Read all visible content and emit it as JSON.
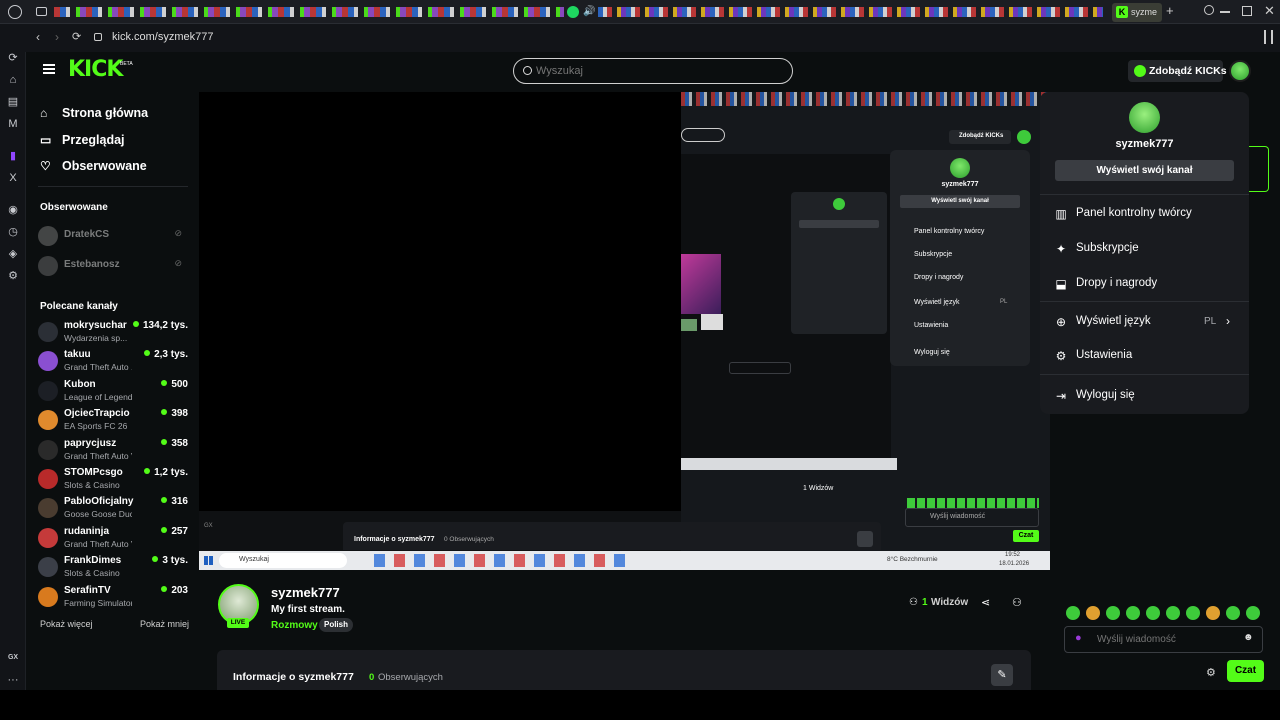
{
  "browser": {
    "tab_label": "syzme",
    "url": "kick.com/syzmek777"
  },
  "header": {
    "logo": "KICK",
    "logo_badge": "BETA",
    "search_placeholder": "Wyszukaj",
    "get_kicks": "Zdobądź KICKs"
  },
  "leftnav": {
    "main": [
      {
        "label": "Strona główna",
        "icon": "home-icon"
      },
      {
        "label": "Przeglądaj",
        "icon": "browse-icon"
      },
      {
        "label": "Obserwowane",
        "icon": "heart-icon"
      }
    ],
    "followed_title": "Obserwowane",
    "followed": [
      {
        "name": "DratekCS"
      },
      {
        "name": "Estebanosz"
      }
    ],
    "recommended_title": "Polecane kanały",
    "recommended": [
      {
        "name": "mokrysuchar",
        "game": "Wydarzenia sp...",
        "viewers": "134,2 tys.",
        "color": "#2b2f36"
      },
      {
        "name": "takuu",
        "game": "Grand Theft Auto ...",
        "viewers": "2,3 tys.",
        "color": "#8a4fd1"
      },
      {
        "name": "Kubon",
        "game": "League of Legends",
        "viewers": "500",
        "color": "#1c1f25"
      },
      {
        "name": "OjciecTrapcio",
        "game": "EA Sports FC 26",
        "viewers": "398",
        "color": "#e08a2d"
      },
      {
        "name": "paprycjusz",
        "game": "Grand Theft Auto V (G...",
        "viewers": "358",
        "color": "#2a2a2a"
      },
      {
        "name": "STOMPcsgo",
        "game": "Slots & Casino",
        "viewers": "1,2 tys.",
        "color": "#b82a2a"
      },
      {
        "name": "PabloOficjalny",
        "game": "Goose Goose Duck",
        "viewers": "316",
        "color": "#4a3c30"
      },
      {
        "name": "rudaninja",
        "game": "Grand Theft Auto V (G...",
        "viewers": "257",
        "color": "#c53a3a"
      },
      {
        "name": "FrankDimes",
        "game": "Slots & Casino",
        "viewers": "3 tys.",
        "color": "#3b3f48"
      },
      {
        "name": "SerafinTV",
        "game": "Farming Simulator 2025",
        "viewers": "203",
        "color": "#d87a1e"
      }
    ],
    "show_more": "Pokaż więcej",
    "show_less": "Pokaż mniej"
  },
  "menu": {
    "username": "syzmek777",
    "view_channel": "Wyświetl swój kanał",
    "items": [
      {
        "label": "Panel kontrolny twórcy",
        "icon": "dashboard-icon"
      },
      {
        "label": "Subskrypcje",
        "icon": "sparkle-icon"
      },
      {
        "label": "Dropy i nagrody",
        "icon": "drops-icon"
      },
      {
        "label": "Wyświetl język",
        "icon": "globe-icon",
        "value": "PL"
      },
      {
        "label": "Ustawienia",
        "icon": "gear-icon"
      },
      {
        "label": "Wyloguj się",
        "icon": "logout-icon"
      }
    ]
  },
  "stream": {
    "username": "syzmek777",
    "title": "My first stream.",
    "category": "Rozmowy",
    "language_tag": "Polish",
    "live_badge": "LIVE",
    "viewers_count": "1",
    "viewers_label": "Widzów",
    "about_title": "Informacje o syzmek777",
    "followers_count": "0",
    "followers_label": "Obserwujących"
  },
  "mirror": {
    "about_title": "Informacje o syzmek777",
    "followers": "0 Obserwujących",
    "viewers": "1 Widzów",
    "chat_placeholder": "Wyślij wiadomość",
    "chat_button": "Czat",
    "taskbar_search": "Wyszukaj",
    "weather": "8°C Bezchmurnie",
    "time": "19:52",
    "date": "18.01.2026",
    "menu_username": "syzmek777",
    "menu_view_channel": "Wyświetl swój kanał",
    "menu_items": [
      "Panel kontrolny twórcy",
      "Subskrypcje",
      "Dropy i nagrody",
      "Wyświetl język",
      "Ustawienia",
      "Wyloguj się"
    ],
    "menu_lang": "PL",
    "get_kicks": "Zdobądź KICKs"
  },
  "chat": {
    "placeholder": "Wyślij wiadomość",
    "send_button": "Czat"
  },
  "gx_sidebar": {
    "label": "GX"
  },
  "colors": {
    "brand": "#53fc18",
    "panel": "#191b1f",
    "background": "#0b0e0f"
  }
}
